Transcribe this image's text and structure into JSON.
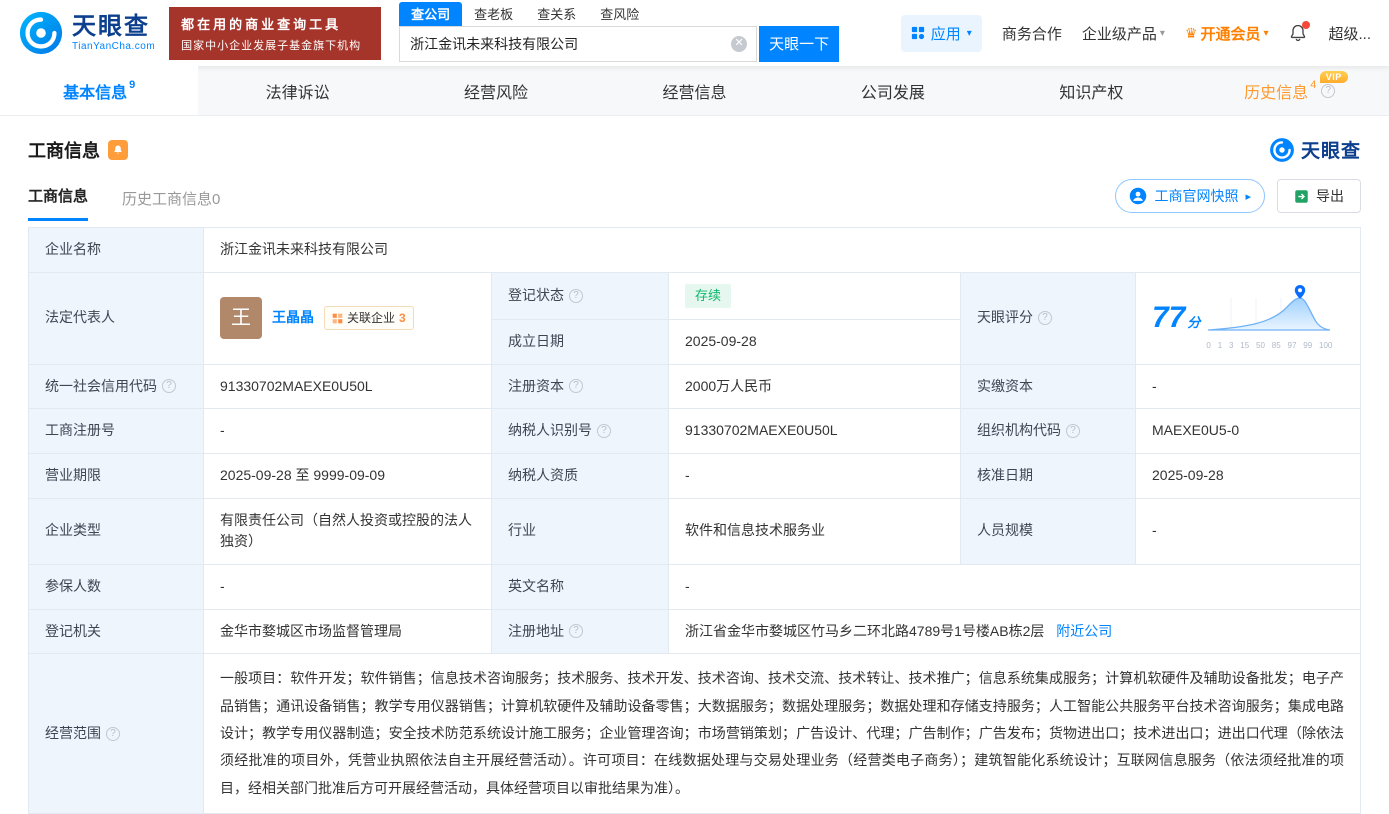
{
  "brand": {
    "name": "天眼查",
    "domain": "TianYanCha.com"
  },
  "header": {
    "promo_line1": "都在用的商业查询工具",
    "promo_line2": "国家中小企业发展子基金旗下机构",
    "search_tabs": [
      {
        "label": "查公司"
      },
      {
        "label": "查老板"
      },
      {
        "label": "查关系"
      },
      {
        "label": "查风险"
      }
    ],
    "search_value": "浙江金讯未来科技有限公司",
    "search_button": "天眼一下",
    "apps_label": "应用",
    "cooperation_label": "商务合作",
    "enterprise_label": "企业级产品",
    "vip_label": "开通会员",
    "super_label": "超级..."
  },
  "nav_tabs": [
    {
      "label": "基本信息",
      "count": "9"
    },
    {
      "label": "法律诉讼"
    },
    {
      "label": "经营风险"
    },
    {
      "label": "经营信息"
    },
    {
      "label": "公司发展"
    },
    {
      "label": "知识产权"
    },
    {
      "label": "历史信息",
      "count": "4",
      "vip_badge": "VIP"
    }
  ],
  "section": {
    "title": "工商信息",
    "logo_text": "天眼查",
    "subtab_active": "工商信息",
    "subtab_history": "历史工商信息0",
    "snapshot_button": "工商官网快照",
    "export_button": "导出"
  },
  "fields": {
    "name": {
      "label": "企业名称",
      "value": "浙江金讯未来科技有限公司"
    },
    "legal_rep": {
      "label": "法定代表人",
      "avatar": "王",
      "person": "王晶晶",
      "related_label": "关联企业",
      "related_count": "3"
    },
    "reg_status": {
      "label": "登记状态",
      "value": "存续"
    },
    "establish_date": {
      "label": "成立日期",
      "value": "2025-09-28"
    },
    "score": {
      "label": "天眼评分",
      "value": "77",
      "unit": "分",
      "ticks": [
        "0",
        "1",
        "3",
        "15",
        "50",
        "85",
        "97",
        "99",
        "100"
      ]
    },
    "credit_code": {
      "label": "统一社会信用代码",
      "value": "91330702MAEXE0U50L"
    },
    "reg_capital": {
      "label": "注册资本",
      "value": "2000万人民币"
    },
    "paid_capital": {
      "label": "实缴资本",
      "value": "-"
    },
    "reg_no": {
      "label": "工商注册号",
      "value": "-"
    },
    "taxpayer_no": {
      "label": "纳税人识别号",
      "value": "91330702MAEXE0U50L"
    },
    "org_code": {
      "label": "组织机构代码",
      "value": "MAEXE0U5-0"
    },
    "term": {
      "label": "营业期限",
      "value": "2025-09-28 至 9999-09-09"
    },
    "taxpayer_quality": {
      "label": "纳税人资质",
      "value": "-"
    },
    "approve_date": {
      "label": "核准日期",
      "value": "2025-09-28"
    },
    "company_type": {
      "label": "企业类型",
      "value": "有限责任公司（自然人投资或控股的法人独资）"
    },
    "industry": {
      "label": "行业",
      "value": "软件和信息技术服务业"
    },
    "staff_size": {
      "label": "人员规模",
      "value": "-"
    },
    "insured_num": {
      "label": "参保人数",
      "value": "-"
    },
    "english_name": {
      "label": "英文名称",
      "value": "-"
    },
    "reg_org": {
      "label": "登记机关",
      "value": "金华市婺城区市场监督管理局"
    },
    "address": {
      "label": "注册地址",
      "value": "浙江省金华市婺城区竹马乡二环北路4789号1号楼AB栋2层",
      "nearby": "附近公司"
    },
    "scope": {
      "label": "经营范围",
      "value": "一般项目：软件开发；软件销售；信息技术咨询服务；技术服务、技术开发、技术咨询、技术交流、技术转让、技术推广；信息系统集成服务；计算机软硬件及辅助设备批发；电子产品销售；通讯设备销售；教学专用仪器销售；计算机软硬件及辅助设备零售；大数据服务；数据处理服务；数据处理和存储支持服务；人工智能公共服务平台技术咨询服务；集成电路设计；教学专用仪器制造；安全技术防范系统设计施工服务；企业管理咨询；市场营销策划；广告设计、代理；广告制作；广告发布；货物进出口；技术进出口；进出口代理（除依法须经批准的项目外，凭营业执照依法自主开展经营活动）。许可项目：在线数据处理与交易处理业务（经营类电子商务）；建筑智能化系统设计；互联网信息服务（依法须经批准的项目，经相关部门批准后方可开展经营活动，具体经营项目以审批结果为准）。"
    }
  },
  "colors": {
    "accent": "#0084ff",
    "vip_orange": "#ff9a2e",
    "status_green": "#0bb869",
    "promo_red": "#a5352b"
  }
}
